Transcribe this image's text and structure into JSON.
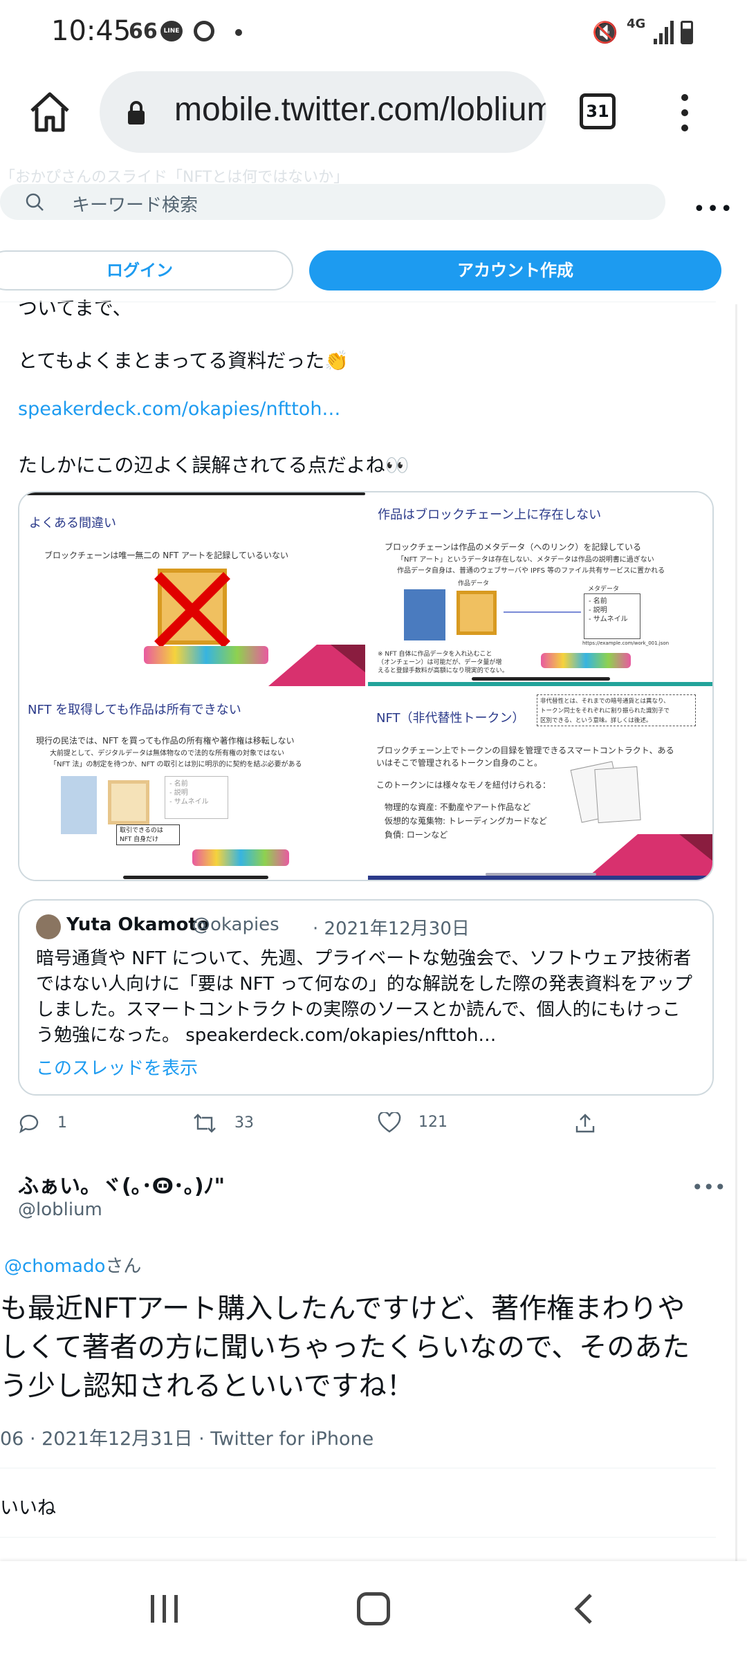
{
  "status_bar": {
    "time": "10:45",
    "extra": "66",
    "line_label": "LINE",
    "network": "4G"
  },
  "browser": {
    "url": "mobile.twitter.com/loblium",
    "tab_count": "31"
  },
  "twitter": {
    "ghost_text": "「おかぴさんのスライド「NFTとは何ではないか」",
    "search_placeholder": "キーワード検索",
    "login_label": "ログイン",
    "signup_label": "アカウント作成"
  },
  "tweet": {
    "line1": "ついてまで、",
    "line2": "とてもよくまとまってる資料だった",
    "line2_emoji": "👏",
    "link": "speakerdeck.com/okapies/nfttoh…",
    "line4": "たしかにこの辺よく誤解されてる点だよね",
    "line4_emoji": "👀"
  },
  "slides": [
    {
      "title": "よくある間違い",
      "body": [
        "ブロックチェーンは唯一無二の NFT アートを記録しているいない"
      ]
    },
    {
      "title": "作品はブロックチェーン上に存在しない",
      "body": [
        "ブロックチェーンは作品のメタデータ（へのリンク）を記録している",
        "「NFT アート」というデータは存在しない、メタデータは作品の説明書に過ぎない",
        "作品データ自身は、普通のウェブサーバや IPFS 等のファイル共有サービスに置かれる",
        "作品データ",
        "メタデータ",
        "- 名前",
        "- 説明",
        "- サムネイル",
        "https://example.com/work_001.json",
        "※ NFT 自体に作品データを入れ込むこと",
        "（オンチェーン）は可能だが、データ量が増",
        "えると登録手数料が高額になり現実的でない。"
      ]
    },
    {
      "title": "NFT を取得しても作品は所有できない",
      "body": [
        "現行の民法では、NFT を買っても作品の所有権や著作権は移転しない",
        "大前提として、デジタルデータは無体物なので法的な所有権の対象ではない",
        "「NFT 法」の制定を待つか、NFT の取引とは別に明示的に契約を結ぶ必要がある",
        "取引できるのは",
        "NFT 自身だけ",
        "- 名前",
        "- 説明",
        "- サムネイル"
      ]
    },
    {
      "title": "NFT（非代替性トークン）",
      "body": [
        "非代替性とは、それまでの暗号通貨とは異なり、",
        "トークン同士をそれぞれに割り振られた識別子で",
        "区別できる、という意味。詳しくは後述。",
        "ブロックチェーン上でトークンの目録を管理できるスマートコントラクト、ある",
        "いはそこで管理されるトークン自身のこと。",
        "このトークンには様々なモノを紐付けられる：",
        "物理的な資産: 不動産やアート作品など",
        "仮想的な蒐集物: トレーディングカードなど",
        "負債: ローンなど"
      ]
    }
  ],
  "quoted": {
    "name": "Yuta Okamoto",
    "handle": "@okapies",
    "date": "· 2021年12月30日",
    "lines": [
      "暗号通貨や NFT について、先週、プライベートな勉強会で、ソフトウェア技術者",
      "ではない人向けに「要は NFT って何なの」的な解説をした際の発表資料をアップ",
      "しました。スマートコントラクトの実際のソースとか読んで、個人的にもけっこ",
      "う勉強になった。 speakerdeck.com/okapies/nfttoh…"
    ],
    "thread_link": "このスレッドを表示"
  },
  "actions": {
    "replies": "1",
    "retweets": "33",
    "likes": "121"
  },
  "tweet2": {
    "name": "ふぁい。ヾ(｡･Ꙫ･｡)ﾉ\"",
    "handle": "@loblium",
    "mention": "@chomado",
    "suffix": "さん",
    "lines": [
      "も最近NFTアート購入したんですけど、著作権まわりや",
      "しくて著者の方に聞いちゃったくらいなので、そのあた",
      "う少し認知されるといいですね！"
    ],
    "meta": "06 · 2021年12月31日 · Twitter for iPhone",
    "likes_label": "いいね"
  },
  "colors": {
    "twitter_blue": "#1d9bf0",
    "text_primary": "#0f1419",
    "text_secondary": "#536471"
  }
}
